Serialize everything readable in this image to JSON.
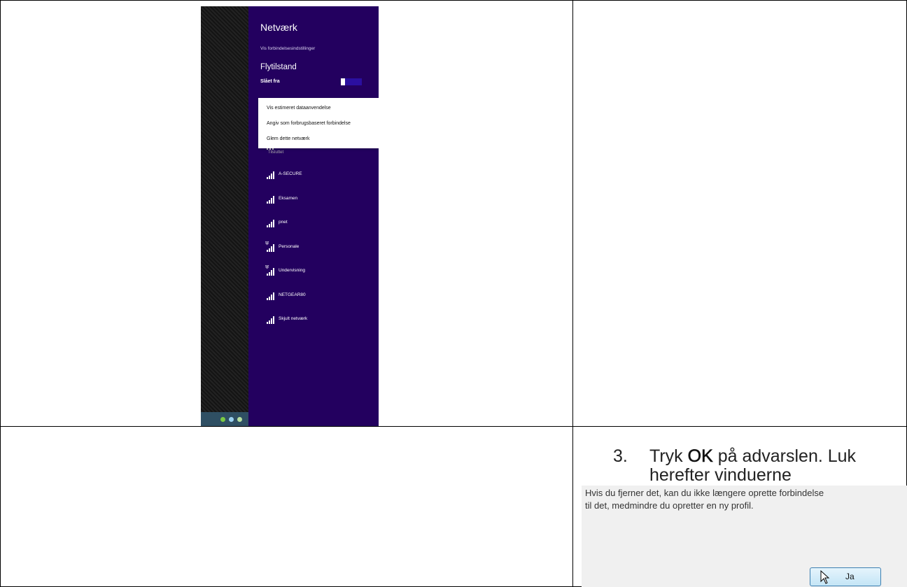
{
  "screenshot_network": {
    "title": "Netværk",
    "link": "Vis forbindelsesindstillinger",
    "airplane_title": "Flytilstand",
    "airplane_state": "Slået fra",
    "context_menu": [
      "Vis estimeret dataanvendelse",
      "Angiv som forbrugsbaseret forbindelse",
      "Glem dette netværk"
    ],
    "connected_status": "Tilsluttet",
    "networks": [
      {
        "name": "A-SECURE",
        "secured": false
      },
      {
        "name": "Eksamen",
        "secured": false
      },
      {
        "name": "pnet",
        "secured": false
      },
      {
        "name": "Personale",
        "secured": true
      },
      {
        "name": "Undervisning",
        "secured": true
      },
      {
        "name": "NETGEAR80",
        "secured": false
      },
      {
        "name": "Skjult netværk",
        "secured": false
      }
    ],
    "accent_color": "#23005f"
  },
  "step": {
    "number": "3.",
    "text_pre": "Tryk ",
    "text_bold": "OK",
    "text_post": " på advarslen. Luk herefter vinduerne"
  },
  "dialog": {
    "message_line1": "Hvis du fjerner det, kan du ikke længere oprette forbindelse",
    "message_line2": "til det, medmindre du opretter en ny profil.",
    "yes_button": "Ja"
  }
}
